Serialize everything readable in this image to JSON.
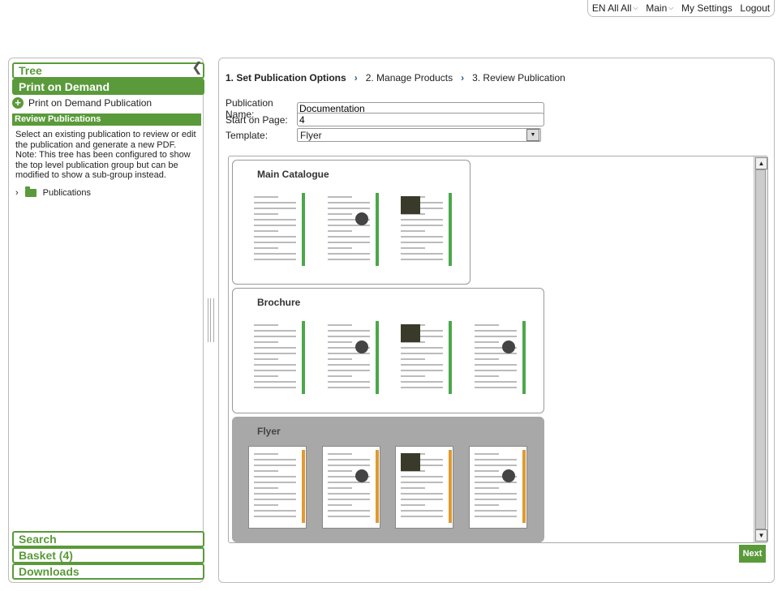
{
  "topbar": {
    "language": "EN All All",
    "main": "Main",
    "settings": "My Settings",
    "logout": "Logout"
  },
  "sidebar": {
    "tree_label": "Tree",
    "print_label": "Print on Demand",
    "pod_link": "Print on Demand Publication",
    "review_header": "Review Publications",
    "description": "Select an existing publication to review or edit the publication and generate a new PDF. Note: This tree has been configured to show the top level publication group but can be modified to show a sub-group instead.",
    "tree_item": "Publications",
    "search_label": "Search",
    "basket_label": "Basket (4)",
    "downloads_label": "Downloads"
  },
  "steps": {
    "step1": "1. Set Publication Options",
    "step2": "2. Manage Products",
    "step3": "3. Review Publication"
  },
  "form": {
    "name_label": "Publication Name:",
    "name_value": "Documentation",
    "start_label": "Start on Page:",
    "start_value": "4",
    "template_label": "Template:",
    "template_value": "Flyer"
  },
  "publications": [
    {
      "title": "Main Catalogue",
      "accent": "#4aa84a",
      "pages": 3,
      "selected": false
    },
    {
      "title": "Brochure",
      "accent": "#4aa84a",
      "pages": 4,
      "selected": false
    },
    {
      "title": "Flyer",
      "accent": "#e09a30",
      "pages": 4,
      "selected": true
    }
  ],
  "next_label": "Next",
  "colors": {
    "brand": "#5a9a3a",
    "step_arrow": "#2a5a8a"
  }
}
